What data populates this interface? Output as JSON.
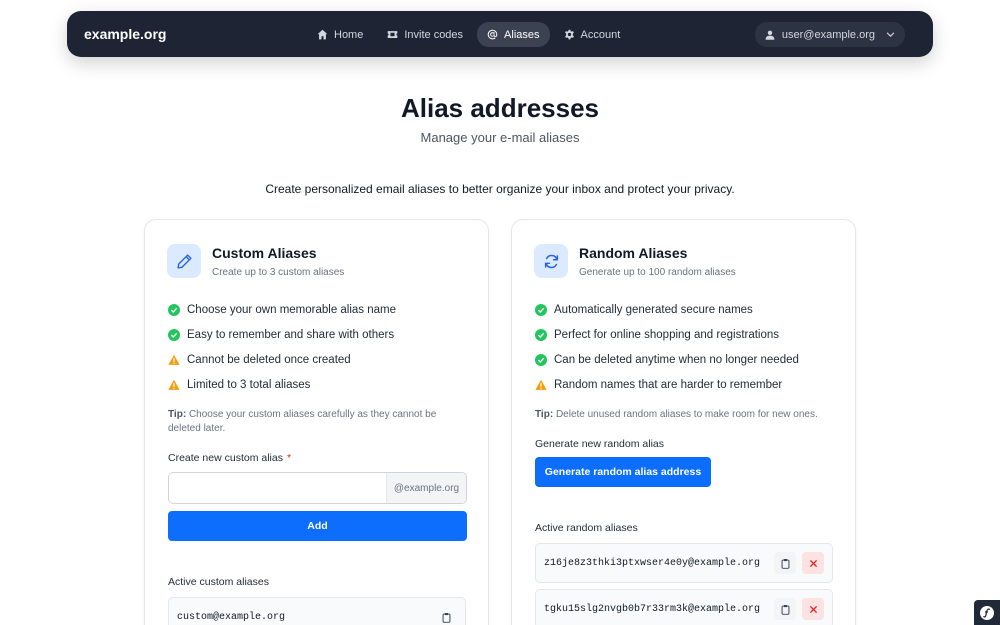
{
  "navbar": {
    "brand": "example.org",
    "links": [
      {
        "label": "Home",
        "icon": "home-icon"
      },
      {
        "label": "Invite codes",
        "icon": "ticket-icon"
      },
      {
        "label": "Aliases",
        "icon": "at-icon",
        "active": true
      },
      {
        "label": "Account",
        "icon": "gear-icon"
      }
    ],
    "user": "user@example.org"
  },
  "header": {
    "title": "Alias addresses",
    "subtitle": "Manage your e-mail aliases",
    "intro": "Create personalized email aliases to better organize your inbox and protect your privacy."
  },
  "custom": {
    "title": "Custom Aliases",
    "subtitle": "Create up to 3 custom aliases",
    "features": [
      {
        "text": "Choose your own memorable alias name",
        "type": "check"
      },
      {
        "text": "Easy to remember and share with others",
        "type": "check"
      },
      {
        "text": "Cannot be deleted once created",
        "type": "warning"
      },
      {
        "text": "Limited to 3 total aliases",
        "type": "warning"
      }
    ],
    "tip_label": "Tip:",
    "tip_text": "Choose your custom aliases carefully as they cannot be deleted later.",
    "input_label": "Create new custom alias",
    "required_mark": "*",
    "input_value": "",
    "input_placeholder": "",
    "suffix": "@example.org",
    "add_label": "Add",
    "active_label": "Active custom aliases",
    "aliases": [
      "custom@example.org"
    ]
  },
  "random": {
    "title": "Random Aliases",
    "subtitle": "Generate up to 100 random aliases",
    "features": [
      {
        "text": "Automatically generated secure names",
        "type": "check"
      },
      {
        "text": "Perfect for online shopping and registrations",
        "type": "check"
      },
      {
        "text": "Can be deleted anytime when no longer needed",
        "type": "check"
      },
      {
        "text": "Random names that are harder to remember",
        "type": "warning"
      }
    ],
    "tip_label": "Tip:",
    "tip_text": "Delete unused random aliases to make room for new ones.",
    "generate_label": "Generate new random alias",
    "generate_button": "Generate random alias address",
    "active_label": "Active random aliases",
    "aliases": [
      "z16je8z3thki3ptxwser4e0y@example.org",
      "tgku15slg2nvgb0b7r33rm3k@example.org"
    ]
  },
  "colors": {
    "navbar": "#1e2433",
    "primary": "#0d6efd",
    "check": "#22c55e",
    "warning": "#f59e0b",
    "danger": "#dc2626"
  }
}
